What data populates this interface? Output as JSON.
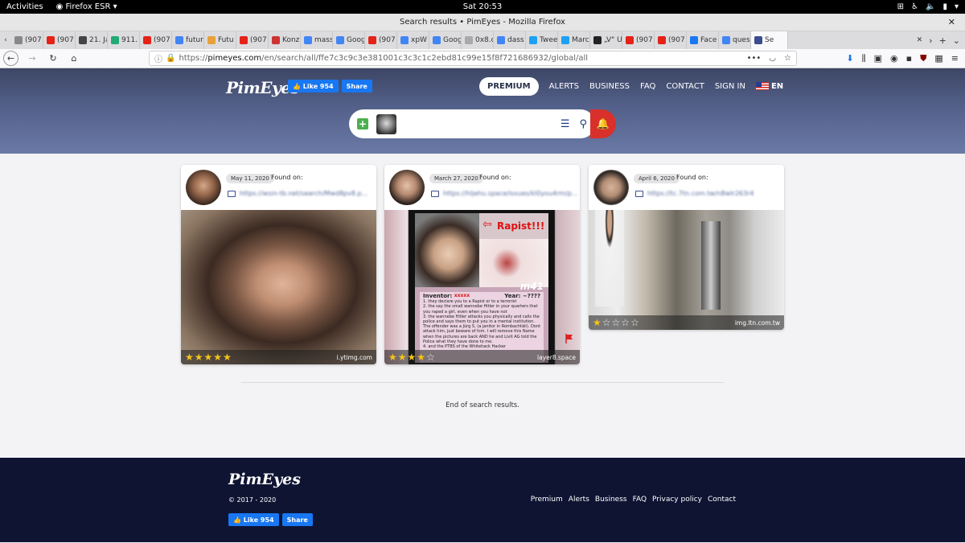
{
  "os": {
    "activities": "Activities",
    "app": "Firefox ESR",
    "clock": "Sat 20:53"
  },
  "window": {
    "title": "Search results • PimEyes - Mozilla Firefox"
  },
  "tabs": [
    {
      "label": "(907",
      "color": "#888"
    },
    {
      "label": "(907",
      "color": "#e62117"
    },
    {
      "label": "21. Ja",
      "color": "#444"
    },
    {
      "label": "911.",
      "color": "#2a7"
    },
    {
      "label": "(907",
      "color": "#e62117"
    },
    {
      "label": "futur",
      "color": "#4285f4"
    },
    {
      "label": "Futu",
      "color": "#e8a03a"
    },
    {
      "label": "(907",
      "color": "#e62117"
    },
    {
      "label": "Konz",
      "color": "#c33"
    },
    {
      "label": "mass",
      "color": "#4285f4"
    },
    {
      "label": "Goog",
      "color": "#4285f4"
    },
    {
      "label": "(907",
      "color": "#e62117"
    },
    {
      "label": "xpW",
      "color": "#4285f4"
    },
    {
      "label": "Goog",
      "color": "#4285f4"
    },
    {
      "label": "0x8.ch/",
      "color": "#aaa"
    },
    {
      "label": "dass",
      "color": "#4285f4"
    },
    {
      "label": "Twee",
      "color": "#1da1f2"
    },
    {
      "label": "Marc",
      "color": "#1da1f2"
    },
    {
      "label": "„V\" U",
      "color": "#222"
    },
    {
      "label": "(907",
      "color": "#e62117"
    },
    {
      "label": "(907",
      "color": "#e62117"
    },
    {
      "label": "Face",
      "color": "#1877f2"
    },
    {
      "label": "ques",
      "color": "#4285f4"
    },
    {
      "label": "Se",
      "color": "#3a4d8f"
    }
  ],
  "url": {
    "scheme": "https://",
    "domain": "pimeyes.com",
    "path": "/en/search/all/ffe7c3c9c3e381001c3c3c1c2ebd81c99e15f8f721686932/global/all"
  },
  "site": {
    "logo": "PimEyes",
    "fb_like": "Like 954",
    "fb_share": "Share",
    "nav": {
      "premium": "PREMIUM",
      "alerts": "ALERTS",
      "business": "BUSINESS",
      "faq": "FAQ",
      "contact": "CONTACT",
      "signin": "SIGN IN",
      "lang": "EN"
    }
  },
  "results": [
    {
      "date": "May 11, 2020",
      "found": "Found on:",
      "link": "https://wsin-tb.net/search/Mwd8pv8.p...",
      "rating": 5,
      "source": "i.ytimg.com"
    },
    {
      "date": "March 27, 2020",
      "found": "Found on:",
      "link": "https://hljehu.space/issues/kl0you4rm/p...",
      "rating": 4,
      "source": "layer8.space",
      "poster": {
        "label": "Rapist!!!",
        "tag": "m41",
        "inventor": "Inventor:",
        "inventor_val": "xxxxx",
        "year": "Year:",
        "year_val": "~????",
        "lines": [
          "1. they declare you to a Rapist or to a terrorist",
          "2. the say the small wannebe Hitler in your quarters that you raped a girl, even when you have not",
          "3. the wannebe Hitler attacks you physically and calls the police and says them to put you in a mental institution. The offender was a Jürg S. (a janitor in Rombachtäli). Dont attack him, just beware of him. I will remove this Name when the pictures are back AND he and LivIt AG told the Police what they have done to me.",
          "4. and the PTBS of the Whitehack Hacker"
        ]
      }
    },
    {
      "date": "April 6, 2020",
      "found": "Found on:",
      "link": "https://tc.7tn.com.tw/n8wlr263r4",
      "rating": 1,
      "source": "img.ltn.com.tw"
    }
  ],
  "end_text": "End of search results.",
  "footer": {
    "logo": "PimEyes",
    "copyright": "© 2017 - 2020",
    "fb_like": "Like 954",
    "fb_share": "Share",
    "links": [
      "Premium",
      "Alerts",
      "Business",
      "FAQ",
      "Privacy policy",
      "Contact"
    ]
  }
}
